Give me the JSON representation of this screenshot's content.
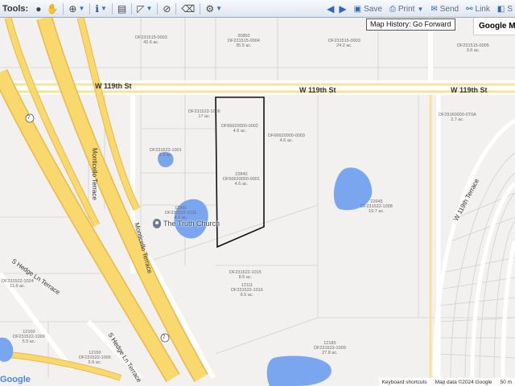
{
  "toolbar": {
    "tools_label": "Tools:",
    "save_label": "Save",
    "print_label": "Print",
    "send_label": "Send",
    "link_label": "Link",
    "s_label": "S"
  },
  "tooltip": "Map History: Go Forward",
  "google_maps_label": "Google Map",
  "roads": {
    "w119_left": "W 119th St",
    "w119_mid": "W 119th St",
    "w119_right": "W 119th St",
    "monticello_1": "Monticello Terrace",
    "monticello_2": "Monticello Terrace",
    "hedge_1": "S Hedge Ln Terrace",
    "hedge_2": "S Hedge Ln Terrace",
    "w119_terrace": "W 119th Terrace",
    "route": "7"
  },
  "place": {
    "church": "The Truth Church"
  },
  "parcels": [
    {
      "id": "p1",
      "line1": "DF231515-0003",
      "line2": "42.6 ac."
    },
    {
      "id": "p2",
      "line1": "20850",
      "line2": "DF231515-0004",
      "line3": "35.5 ac."
    },
    {
      "id": "p3",
      "line1": "DF231515-0003",
      "line2": "24.2 ac."
    },
    {
      "id": "p4",
      "line1": "DF231515-0005",
      "line2": "3.6 ac."
    },
    {
      "id": "p5",
      "line1": "DF66620000-0002",
      "line2": "4.6 ac."
    },
    {
      "id": "p6",
      "line1": "DF66620000-0003",
      "line2": "4.6 ac."
    },
    {
      "id": "p7",
      "line1": "22840",
      "line2": "DF66620000-0001",
      "line3": "4.6 ac."
    },
    {
      "id": "p8",
      "line1": "DF231522-1001",
      "line2": "2.2 ac."
    },
    {
      "id": "p9",
      "line1": "DF231522-1006",
      "line2": "17 ac."
    },
    {
      "id": "p10",
      "line1": "DF29160000-0T0A",
      "line2": "2.7 ac."
    },
    {
      "id": "p11",
      "line1": "22645",
      "line2": "DF231522-1008",
      "line3": "19.7 ac."
    },
    {
      "id": "p12",
      "line1": "11901",
      "line2": "DF231522-1011",
      "line3": "4.3 ac."
    },
    {
      "id": "p13",
      "line1": "DF231522-1015",
      "line2": "8.5 ac."
    },
    {
      "id": "p14",
      "line1": "12111",
      "line2": "DF231522-1016",
      "line3": "6.5 ac."
    },
    {
      "id": "p15",
      "line1": "DF231522-1024",
      "line2": "11.6 ac."
    },
    {
      "id": "p16",
      "line1": "12100",
      "line2": "DF231522-1009",
      "line3": "5.5 ac."
    },
    {
      "id": "p17",
      "line1": "12150",
      "line2": "DF231522-1005",
      "line3": "5.5 ac."
    },
    {
      "id": "p18",
      "line1": "12185",
      "line2": "DF231522-1009",
      "line3": "27.8 ac."
    }
  ],
  "footer": {
    "google": "Google",
    "shortcuts": "Keyboard shortcuts",
    "data": "Map data ©2024 Google",
    "scale": "50 m"
  },
  "colors": {
    "highway": "#f9d86d",
    "highway_edge": "#e8b94a",
    "arterial": "#f5e39c",
    "parcel_line": "#cfcfcf",
    "water": "#7aa6f0",
    "selection": "#111111"
  }
}
